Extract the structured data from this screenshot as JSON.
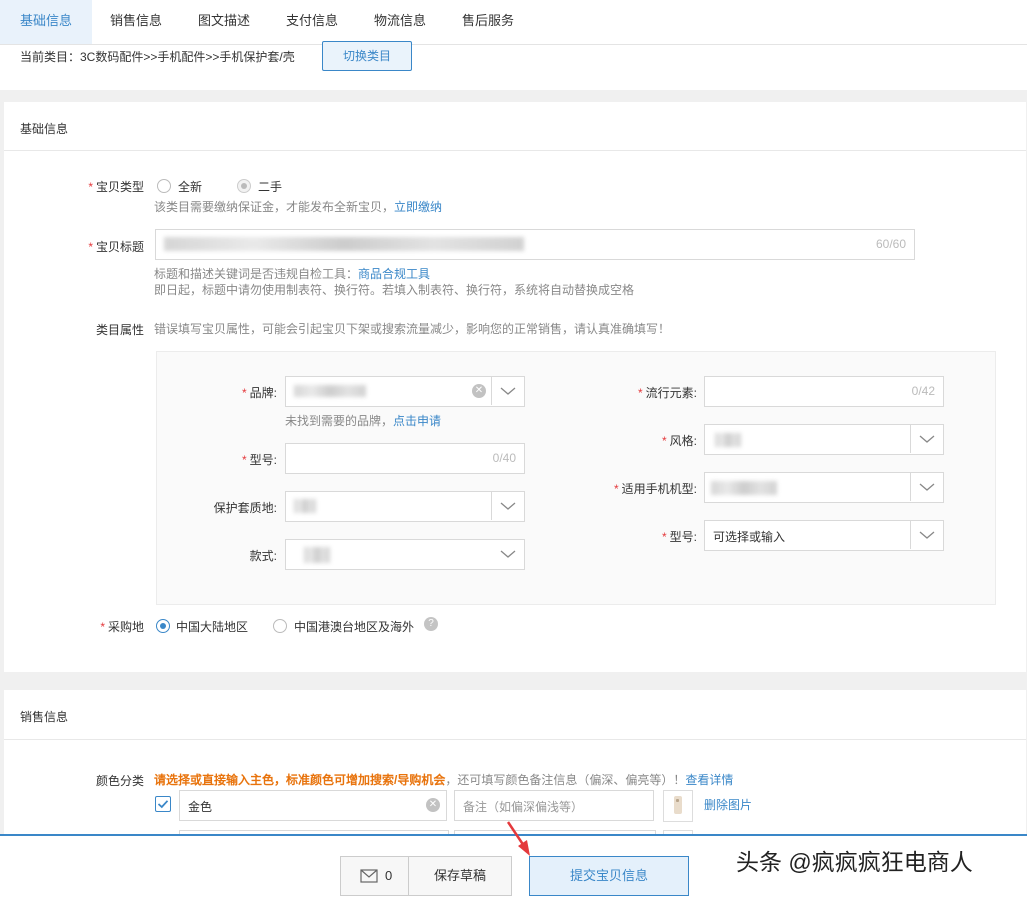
{
  "tabs": [
    "基础信息",
    "销售信息",
    "图文描述",
    "支付信息",
    "物流信息",
    "售后服务"
  ],
  "category": {
    "path": "当前类目：3C数码配件>>手机配件>>手机保护套/壳",
    "switch_label": "切换类目"
  },
  "basic": {
    "section_title": "基础信息",
    "item_type": {
      "label": "宝贝类型",
      "options": [
        "全新",
        "二手"
      ],
      "hint_text": "该类目需要缴纳保证金，才能发布全新宝贝，",
      "hint_link": "立即缴纳"
    },
    "title_field": {
      "label": "宝贝标题",
      "counter": "60/60",
      "hint1_text": "标题和描述关键词是否违规自检工具：",
      "hint1_link": "商品合规工具",
      "hint2": "即日起，标题中请勿使用制表符、换行符。若填入制表符、换行符，系统将自动替换成空格"
    },
    "attributes": {
      "label": "类目属性",
      "warning": "错误填写宝贝属性，可能会引起宝贝下架或搜索流量减少，影响您的正常销售，请认真准确填写！",
      "brand": {
        "label": "品牌:",
        "hint_text": "未找到需要的品牌，",
        "hint_link": "点击申请"
      },
      "model_left": {
        "label": "型号:",
        "counter": "0/40"
      },
      "material": {
        "label": "保护套质地:"
      },
      "style_left": {
        "label": "款式:"
      },
      "trend": {
        "label": "流行元素:",
        "counter": "0/42"
      },
      "style_right": {
        "label": "风格:"
      },
      "phone_model": {
        "label": "适用手机机型:"
      },
      "model_right": {
        "label": "型号:",
        "placeholder": "可选择或输入"
      }
    },
    "purchase_place": {
      "label": "采购地",
      "options": [
        "中国大陆地区",
        "中国港澳台地区及海外"
      ],
      "help_icon": "?"
    }
  },
  "sales": {
    "section_title": "销售信息",
    "color": {
      "label": "颜色分类",
      "hint_orange": "请选择或直接输入主色，标准颜色可增加搜索/导购机会",
      "hint_gray": "，还可填写颜色备注信息（偏深、偏亮等）！",
      "hint_link": "查看详情",
      "first_value": "金色",
      "note_placeholder": "备注（如偏深偏浅等）",
      "delete_image": "删除图片"
    }
  },
  "bottom": {
    "message_count": "0",
    "save_draft": "保存草稿",
    "submit": "提交宝贝信息"
  },
  "watermark": "头条 @疯疯疯狂电商人",
  "colors": {
    "accent": "#3a87c8",
    "required": "#e4393c",
    "warning_orange": "#e8730c"
  }
}
